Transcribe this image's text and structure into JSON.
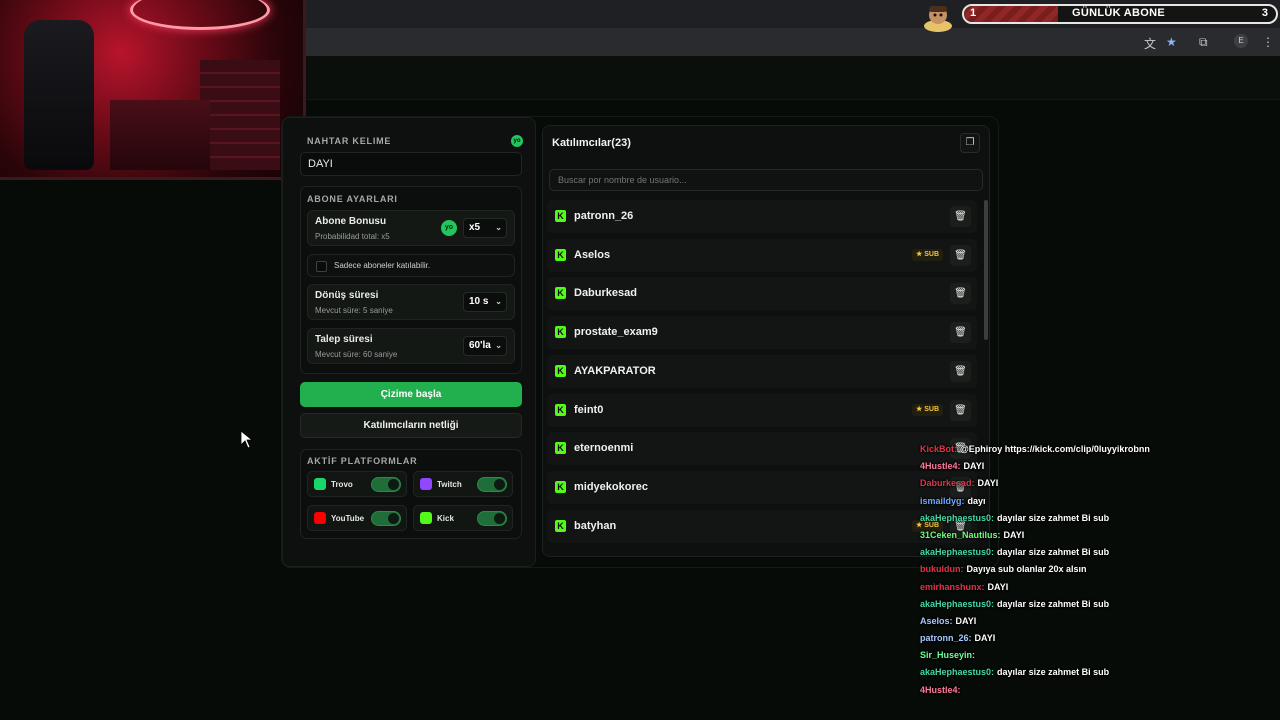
{
  "browser": {
    "subgoal": {
      "left": "1",
      "title": "GÜNLÜK ABONE",
      "right": "3",
      "progress": 0.3
    },
    "profile_initial": "E",
    "icons": [
      "translate-icon",
      "star-icon",
      "extensions-icon",
      "menu-icon"
    ]
  },
  "keyword": {
    "label": "ANAHTAR KELIME",
    "label_visible": "NAHTAR KELIME",
    "badge": "yo",
    "value": "DAYI"
  },
  "sub_settings": {
    "label": "ABONE AYARLARI",
    "bonus": {
      "title": "Abone Bonusu",
      "subtitle": "Probabilidad total: x5",
      "badge": "yo",
      "value": "x5"
    },
    "only_subs": "Sadece aboneler katılabilir.",
    "spin": {
      "title": "Dönüş süresi",
      "subtitle": "Mevcut süre: 5 saniye",
      "value": "10 s"
    },
    "claim": {
      "title": "Talep süresi",
      "subtitle": "Mevcut süre: 60 saniye",
      "value": "60'la"
    }
  },
  "buttons": {
    "start": "Çizime başla",
    "clear": "Katılımcıların netliği"
  },
  "platforms": {
    "label": "AKTİF PLATFORMLAR",
    "items": [
      {
        "name": "Trovo",
        "color": "#19d66b",
        "on": true
      },
      {
        "name": "Twitch",
        "color": "#9146ff",
        "on": true
      },
      {
        "name": "YouTube",
        "color": "#ff0000",
        "on": true
      },
      {
        "name": "Kick",
        "color": "#53fc18",
        "on": true
      }
    ]
  },
  "participants": {
    "title": "Katılımcılar(23)",
    "search_placeholder": "Buscar por nombre de usuario...",
    "sub_label": "SUB",
    "rows": [
      {
        "name": "patronn_26",
        "sub": false
      },
      {
        "name": "Aselos",
        "sub": true
      },
      {
        "name": "Daburkesad",
        "sub": false
      },
      {
        "name": "prostate_exam9",
        "sub": false
      },
      {
        "name": "AYAKPARATOR",
        "sub": false
      },
      {
        "name": "feint0",
        "sub": true
      },
      {
        "name": "eternoenmi",
        "sub": false
      },
      {
        "name": "midyekokorec",
        "sub": false
      },
      {
        "name": "batyhan",
        "sub": true
      }
    ]
  },
  "chat": [
    {
      "user": "KickBot:",
      "color": "#e2334a",
      "text": "@Ephiroy https://kick.com/clip/0luyyikrobnn"
    },
    {
      "user": "4Hustle4:",
      "color": "#ff7a9a",
      "text": "DAYI"
    },
    {
      "user": "Daburkesad:",
      "color": "#e2334a",
      "text": "DAYI"
    },
    {
      "user": "ismaildyg:",
      "color": "#6fa8ff",
      "text": "dayı"
    },
    {
      "user": "akaHephaestus0:",
      "color": "#45d8a8",
      "text": "dayılar size zahmet Bi sub"
    },
    {
      "user": "31Ceken_Nautilus:",
      "color": "#6dff7a",
      "text": "DAYI"
    },
    {
      "user": "akaHephaestus0:",
      "color": "#45d8a8",
      "text": "dayılar size zahmet Bi sub"
    },
    {
      "user": "bukuldun:",
      "color": "#e2334a",
      "text": "Dayıya sub olanlar 20x alsın"
    },
    {
      "user": "emirhanshunx:",
      "color": "#e2334a",
      "text": "DAYI"
    },
    {
      "user": "akaHephaestus0:",
      "color": "#45d8a8",
      "text": "dayılar size zahmet Bi sub"
    },
    {
      "user": "Aselos:",
      "color": "#a8c8ff",
      "text": "DAYI"
    },
    {
      "user": "patronn_26:",
      "color": "#a8c8ff",
      "text": "DAYI"
    },
    {
      "user": "Sir_Huseyin:",
      "color": "#6dff9a",
      "text": ""
    },
    {
      "user": "akaHephaestus0:",
      "color": "#45d8a8",
      "text": "dayılar size zahmet Bi sub"
    },
    {
      "user": "4Hustle4:",
      "color": "#ff7a9a",
      "text": ""
    }
  ]
}
